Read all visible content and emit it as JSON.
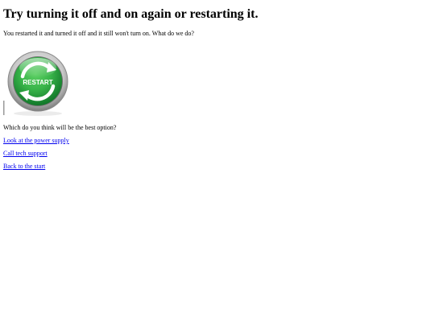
{
  "page": {
    "title": "Try turning it off and on again or restarting it.",
    "intro": "You restarted it and turned it off and it still won't turn on. What do we do?",
    "question": "Which do you think will be the best option?"
  },
  "image": {
    "icon": "restart-icon",
    "label": "RESTART",
    "colors": {
      "ring_outer": "#c9c9c9",
      "ring_inner": "#7b7b7b",
      "green_dark": "#0b6e24",
      "green_light": "#39b54a"
    }
  },
  "choices": [
    {
      "label": "Look at the power supply"
    },
    {
      "label": "Call tech support"
    },
    {
      "label": "Back to the start"
    }
  ],
  "colors": {
    "link": "#0000ee",
    "text": "#000000",
    "background": "#ffffff"
  }
}
